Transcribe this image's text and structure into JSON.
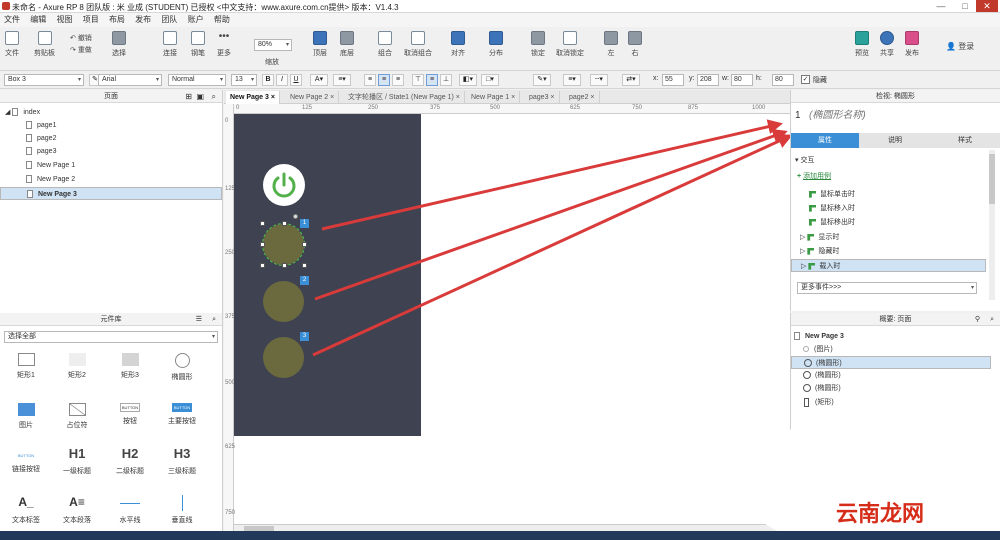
{
  "window": {
    "title": "未命名 - Axure RP 8 团队版 : 米 业成 (STUDENT) 已授权     <中文支持：www.axure.com.cn提供> 版本：V1.4.3",
    "controls": [
      "—",
      "□",
      "✕"
    ]
  },
  "menu": [
    "文件",
    "编辑",
    "视图",
    "项目",
    "布局",
    "发布",
    "团队",
    "账户",
    "帮助"
  ],
  "toolbar": {
    "file": "文件",
    "clipboard": "剪贴板",
    "undo": "撤销",
    "redo": "重做",
    "select": "选择",
    "connect": "连接",
    "pen": "钢笔",
    "more": "更多",
    "zoom_value": "80%",
    "zoom": "缩放",
    "top": "顶层",
    "bottom": "底层",
    "group": "组合",
    "ungroup": "取消组合",
    "align": "对齐",
    "distribute": "分布",
    "lock": "锁定",
    "unlock": "取消锁定",
    "left": "左",
    "right": "右",
    "preview": "预览",
    "share": "共享",
    "publish": "发布",
    "login": "登录"
  },
  "format": {
    "widget_name": "Box 3",
    "font": "Arial",
    "style": "Normal",
    "size": "13",
    "bold": "B",
    "italic": "I",
    "underline": "U",
    "x_label": "x:",
    "x": "55",
    "y_label": "y:",
    "y": "208",
    "w_label": "w:",
    "w": "80",
    "h_label": "h:",
    "h": "80",
    "hidden": "隐藏"
  },
  "pages_panel": {
    "title": "页面",
    "root": "index",
    "items": [
      "page1",
      "page2",
      "page3",
      "New Page 1",
      "New Page 2",
      "New Page 3"
    ]
  },
  "library": {
    "title": "元件库",
    "filter": "选择全部",
    "items": [
      "矩形1",
      "矩形2",
      "矩形3",
      "椭圆形",
      "图片",
      "占位符",
      "按钮",
      "主要按钮",
      "链接按钮",
      "一级标题",
      "二级标题",
      "三级标题",
      "文本标签",
      "文本段落",
      "水平线",
      "垂直线"
    ],
    "button_text": "BUTTON",
    "h1": "H1",
    "h2": "H2",
    "h3": "H3"
  },
  "tabs": [
    "New Page 3",
    "New Page 2",
    "文字轮播区 / State1 (New Page 1)",
    "New Page 1",
    "page3",
    "page2"
  ],
  "ruler": {
    "h": [
      "0",
      "125",
      "250",
      "375",
      "500",
      "625",
      "750",
      "875",
      "1000"
    ],
    "v": [
      "0",
      "125",
      "250",
      "375",
      "500",
      "625",
      "750"
    ]
  },
  "canvas": {
    "badges": [
      "1",
      "2",
      "3"
    ]
  },
  "inspector": {
    "title": "检视: 椭圆形",
    "index": "1",
    "name_placeholder": "(椭圆形名称)",
    "tabs": [
      "属性",
      "说明",
      "样式"
    ],
    "section": "交互",
    "add_case": "添加用例",
    "events": [
      "鼠标单击时",
      "鼠标移入时",
      "鼠标移出时",
      "显示时",
      "隐藏时",
      "载入时"
    ],
    "more_events": "更多事件>>>"
  },
  "outline": {
    "title": "概要: 页面",
    "root": "New Page 3",
    "items": [
      "(图片)",
      "(椭圆形)",
      "(椭圆形)",
      "(椭圆形)",
      "(矩形)"
    ]
  },
  "watermark": "云南龙网",
  "colors": {
    "device": "#3f4250",
    "circle": "#6b6a3e",
    "power": "#53b04a",
    "arrow": "#d93a3a",
    "accent": "#3a8fd6"
  }
}
